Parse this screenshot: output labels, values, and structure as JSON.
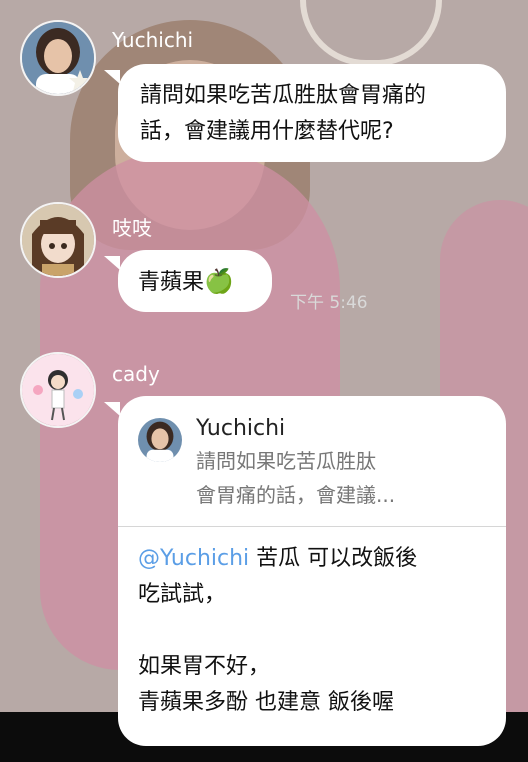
{
  "messages": [
    {
      "sender": "Yuchichi",
      "text_lines": [
        "請問如果吃苦瓜胜肽會胃痛的",
        "話，會建議用什麼替代呢?"
      ]
    },
    {
      "sender": "吱吱",
      "text": "青蘋果",
      "emoji": "🍏",
      "time": "下午 5:46"
    },
    {
      "sender": "cady",
      "quoted": {
        "name": "Yuchichi",
        "lines": [
          "請問如果吃苦瓜胜肽",
          "會胃痛的話，會建議..."
        ]
      },
      "mention": "@Yuchichi",
      "line1_rest": " 苦瓜 可以改飯後",
      "line2": "吃試試，",
      "line4": "如果胃不好，",
      "line5": "青蘋果多酚 也建意 飯後喔"
    }
  ],
  "colors": {
    "mention": "#5b9ee6",
    "bubble": "#ffffff",
    "sender_text": "#ffffff"
  }
}
